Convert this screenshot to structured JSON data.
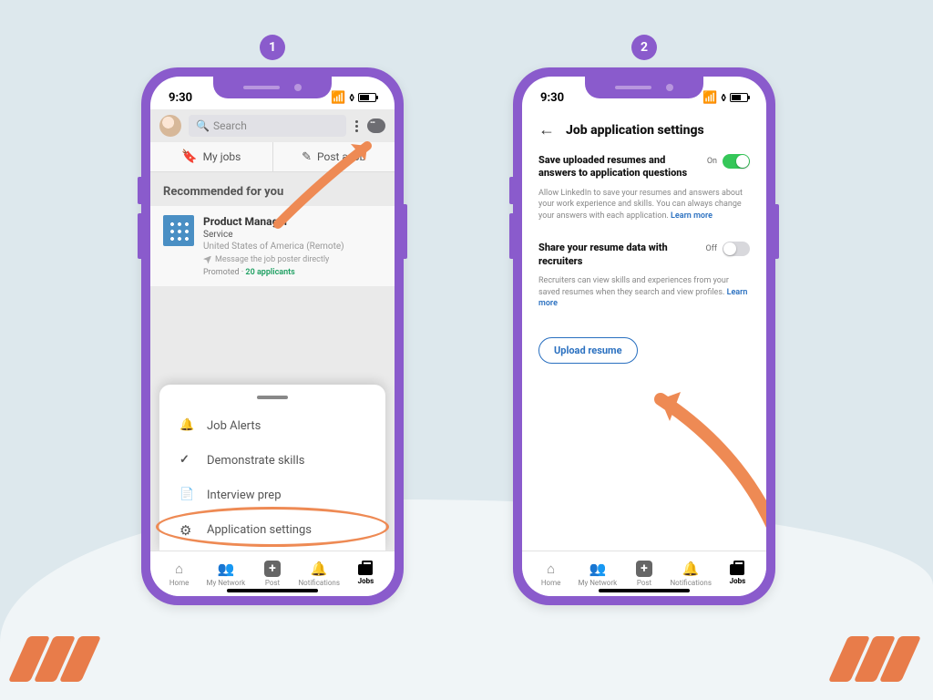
{
  "status": {
    "time": "9:30"
  },
  "step_labels": {
    "one": "1",
    "two": "2"
  },
  "screen1": {
    "search_placeholder": "Search",
    "tabs": {
      "my_jobs": "My jobs",
      "post_job": "Post a job"
    },
    "section_title": "Recommended for you",
    "job": {
      "title": "Product Manager",
      "company": "Service",
      "location": "United States of America (Remote)",
      "message": "Message the job poster directly",
      "promoted": "Promoted",
      "applicants": "20 applicants"
    },
    "sheet": {
      "job_alerts": "Job Alerts",
      "demonstrate_skills": "Demonstrate skills",
      "interview_prep": "Interview prep",
      "application_settings": "Application settings"
    }
  },
  "screen2": {
    "title": "Job application settings",
    "setting1": {
      "title": "Save uploaded resumes and answers to application questions",
      "state_label": "On",
      "desc": "Allow LinkedIn to save your resumes and answers about your work experience and skills. You can always change your answers with each application.",
      "learn_more": "Learn more"
    },
    "setting2": {
      "title": "Share your resume data with recruiters",
      "state_label": "Off",
      "desc": "Recruiters can view skills and experiences from your saved resumes when they search and view profiles.",
      "learn_more": "Learn more"
    },
    "upload_label": "Upload resume"
  },
  "nav": {
    "home": "Home",
    "network": "My Network",
    "post": "Post",
    "notifications": "Notifications",
    "jobs": "Jobs"
  }
}
